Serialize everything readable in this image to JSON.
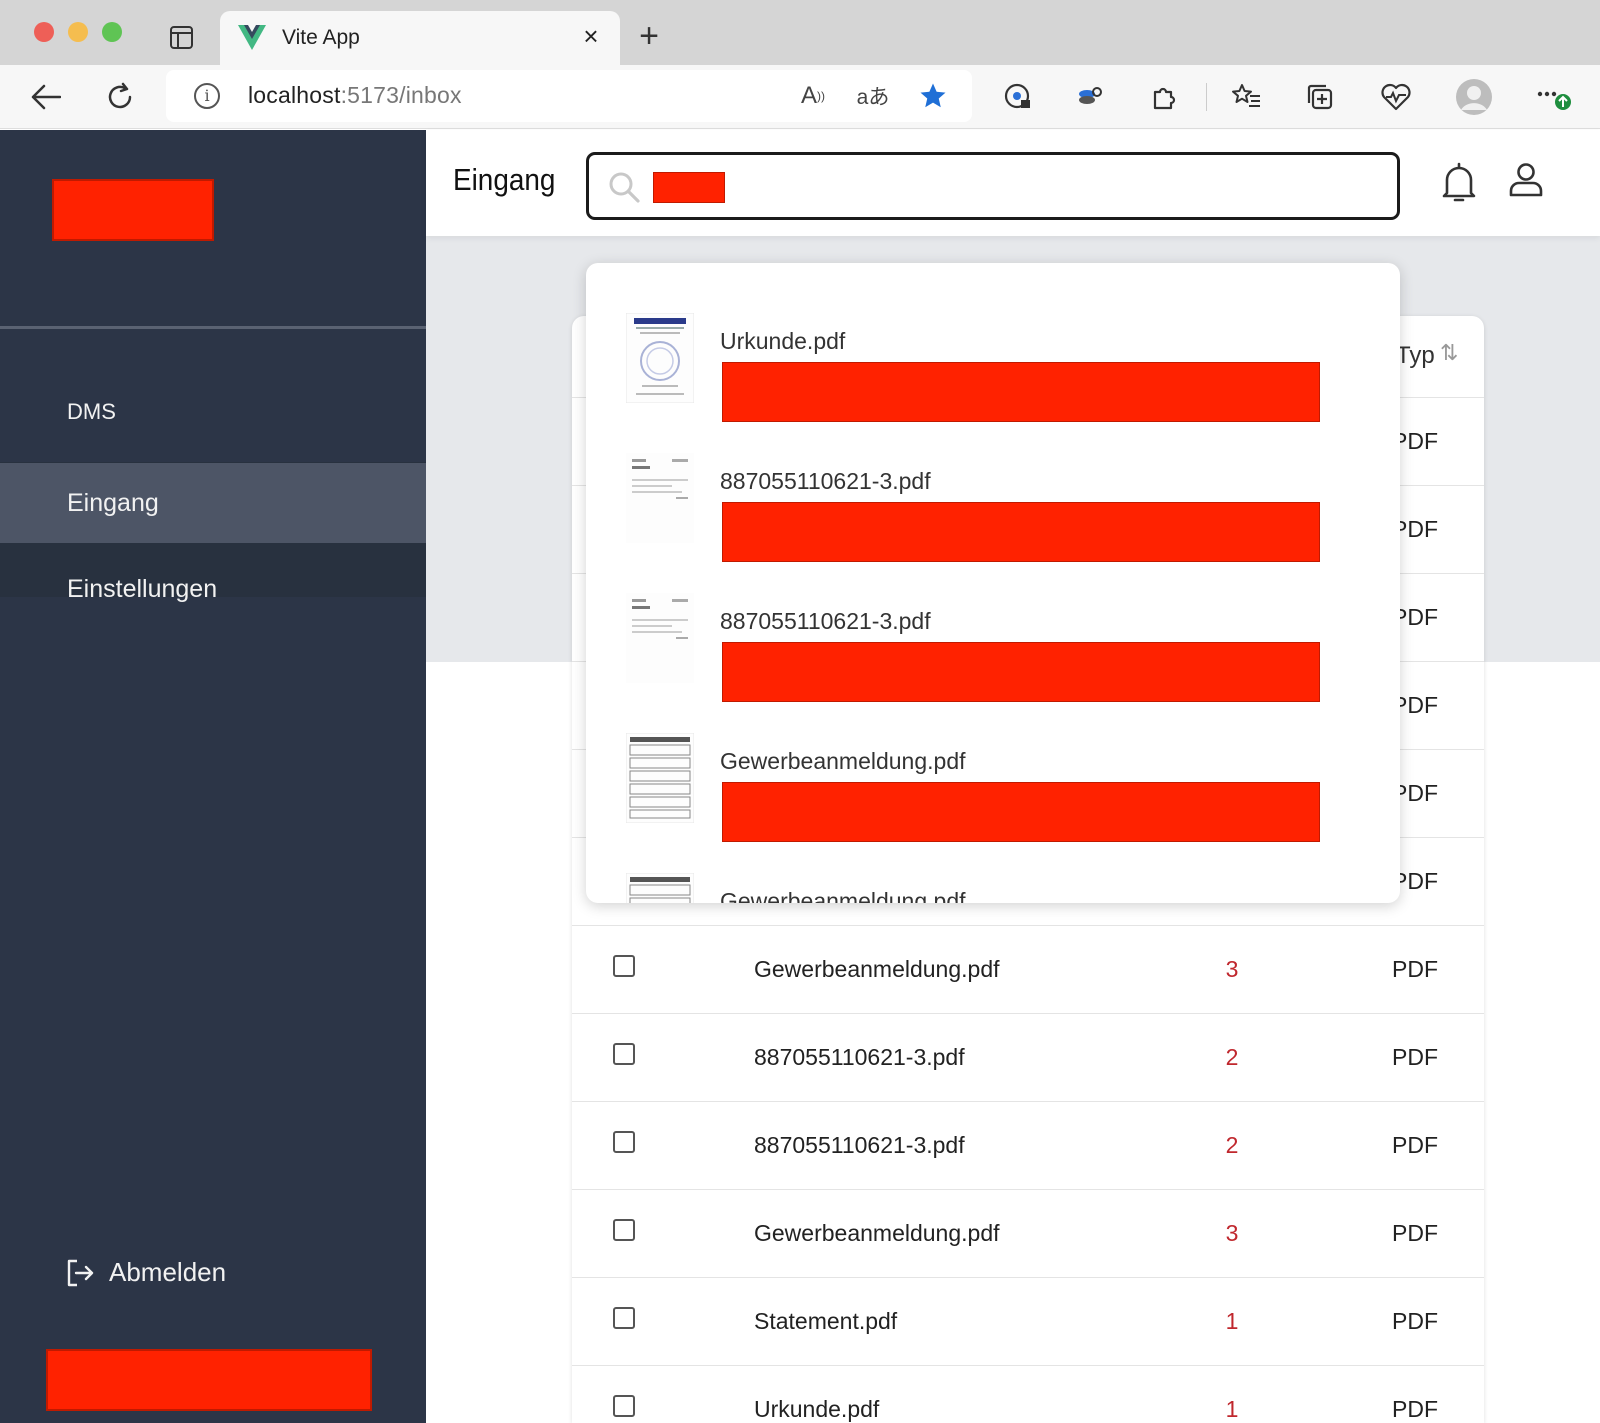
{
  "browser": {
    "tab_title": "Vite App",
    "tab_close": "×",
    "new_tab": "+",
    "url_host": "localhost",
    "url_rest": ":5173/inbox"
  },
  "sidebar": {
    "items": [
      {
        "label": "DMS"
      },
      {
        "label": "Eingang",
        "active": true
      },
      {
        "label": "Einstellungen"
      }
    ],
    "logout_label": "Abmelden"
  },
  "header": {
    "title": "Eingang"
  },
  "dropdown": {
    "results": [
      {
        "name": "Urkunde.pdf",
        "thumb": "certificate"
      },
      {
        "name": "887055110621-3.pdf",
        "thumb": "letter"
      },
      {
        "name": "887055110621-3.pdf",
        "thumb": "letter"
      },
      {
        "name": "Gewerbeanmeldung.pdf",
        "thumb": "form"
      },
      {
        "name": "Gewerbeanmeldung.pdf",
        "thumb": "form"
      }
    ]
  },
  "table": {
    "type_header": "Typ",
    "rows": [
      {
        "name": "",
        "count": "",
        "type": "PDF"
      },
      {
        "name": "",
        "count": "",
        "type": "PDF"
      },
      {
        "name": "",
        "count": "",
        "type": "PDF"
      },
      {
        "name": "",
        "count": "",
        "type": "PDF"
      },
      {
        "name": "",
        "count": "",
        "type": "PDF"
      },
      {
        "name": "",
        "count": "",
        "type": "PDF"
      },
      {
        "name": "Gewerbeanmeldung.pdf",
        "count": "3",
        "type": "PDF"
      },
      {
        "name": "887055110621-3.pdf",
        "count": "2",
        "type": "PDF"
      },
      {
        "name": "887055110621-3.pdf",
        "count": "2",
        "type": "PDF"
      },
      {
        "name": "Gewerbeanmeldung.pdf",
        "count": "3",
        "type": "PDF"
      },
      {
        "name": "Statement.pdf",
        "count": "1",
        "type": "PDF"
      },
      {
        "name": "Urkunde.pdf",
        "count": "1",
        "type": "PDF"
      }
    ]
  },
  "colors": {
    "sidebar_bg": "#2c3547",
    "sidebar_active": "#4d5566",
    "redaction": "#ff2200",
    "count_red": "#c0272d",
    "favorite_star": "#1f6fd6",
    "vue_green": "#42b883",
    "vue_dark": "#35495e"
  },
  "icons": {
    "back": "arrow-left-icon",
    "reload": "reload-icon",
    "favorite": "star-icon",
    "search": "search-icon",
    "bell": "bell-icon",
    "user": "user-icon",
    "logout": "logout-icon"
  }
}
